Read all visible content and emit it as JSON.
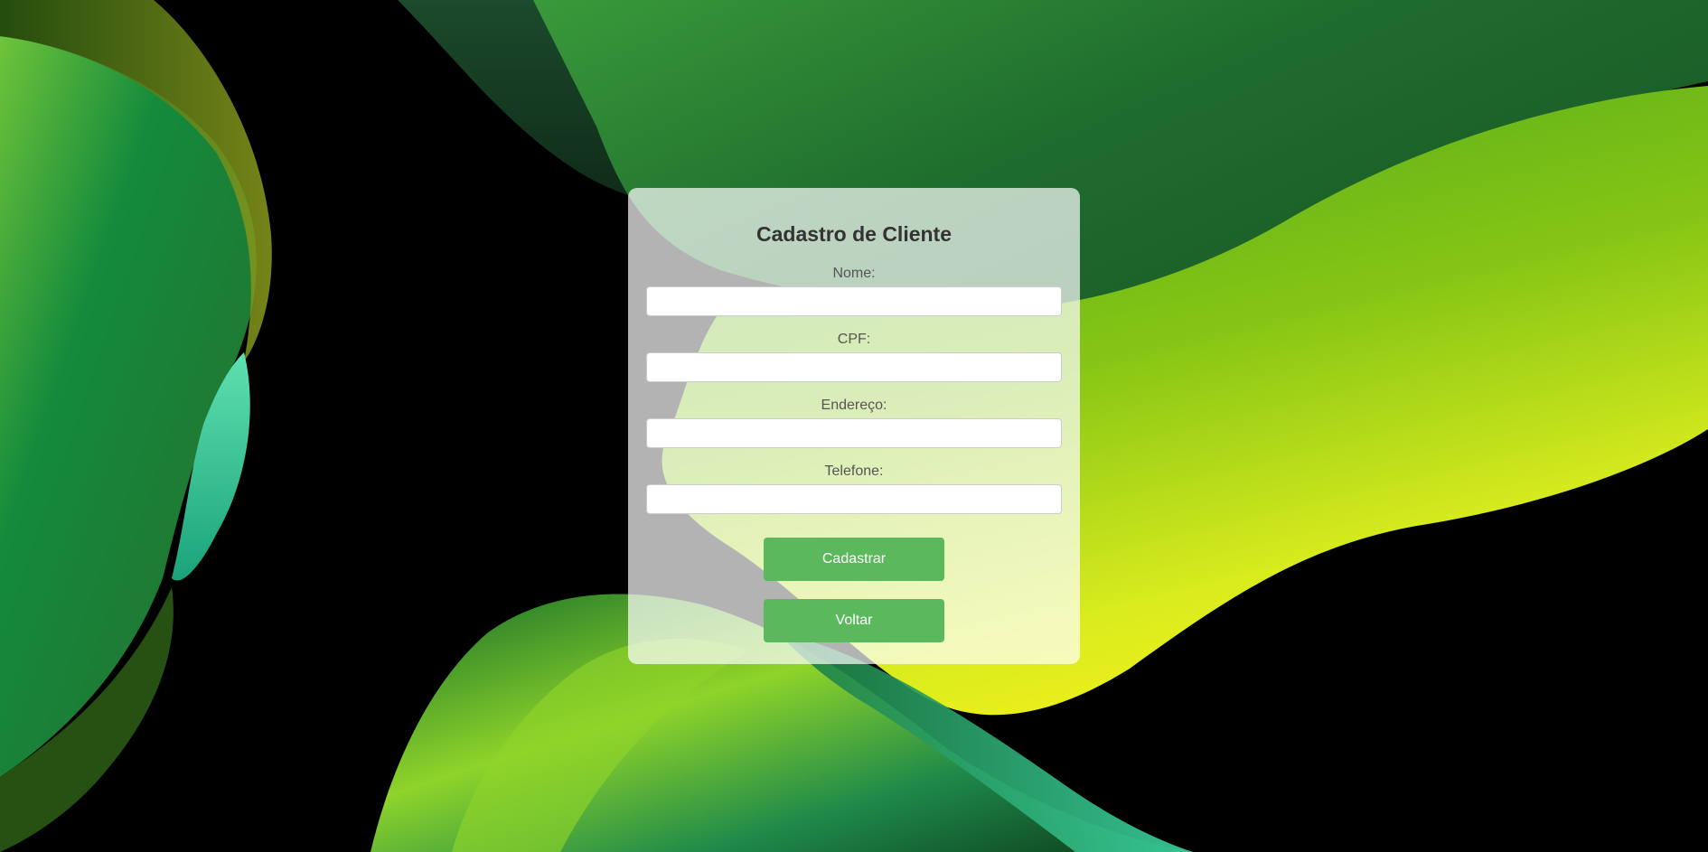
{
  "page": {
    "background_color": "#000000"
  },
  "form": {
    "title": "Cadastro de Cliente",
    "fields": [
      {
        "label": "Nome:",
        "value": "",
        "placeholder": ""
      },
      {
        "label": "CPF:",
        "value": "",
        "placeholder": ""
      },
      {
        "label": "Endereço:",
        "value": "",
        "placeholder": ""
      },
      {
        "label": "Telefone:",
        "value": "",
        "placeholder": ""
      }
    ],
    "submit_label": "Cadastrar",
    "back_label": "Voltar"
  },
  "colors": {
    "button": "#5cb85c",
    "button_text": "#ffffff",
    "title_text": "#333333",
    "label_text": "#555555",
    "wallpaper_greens": [
      "#1b6b2a",
      "#2e8b35",
      "#4fae2a",
      "#9ed41a",
      "#eef01c",
      "#3ad3a0"
    ]
  }
}
